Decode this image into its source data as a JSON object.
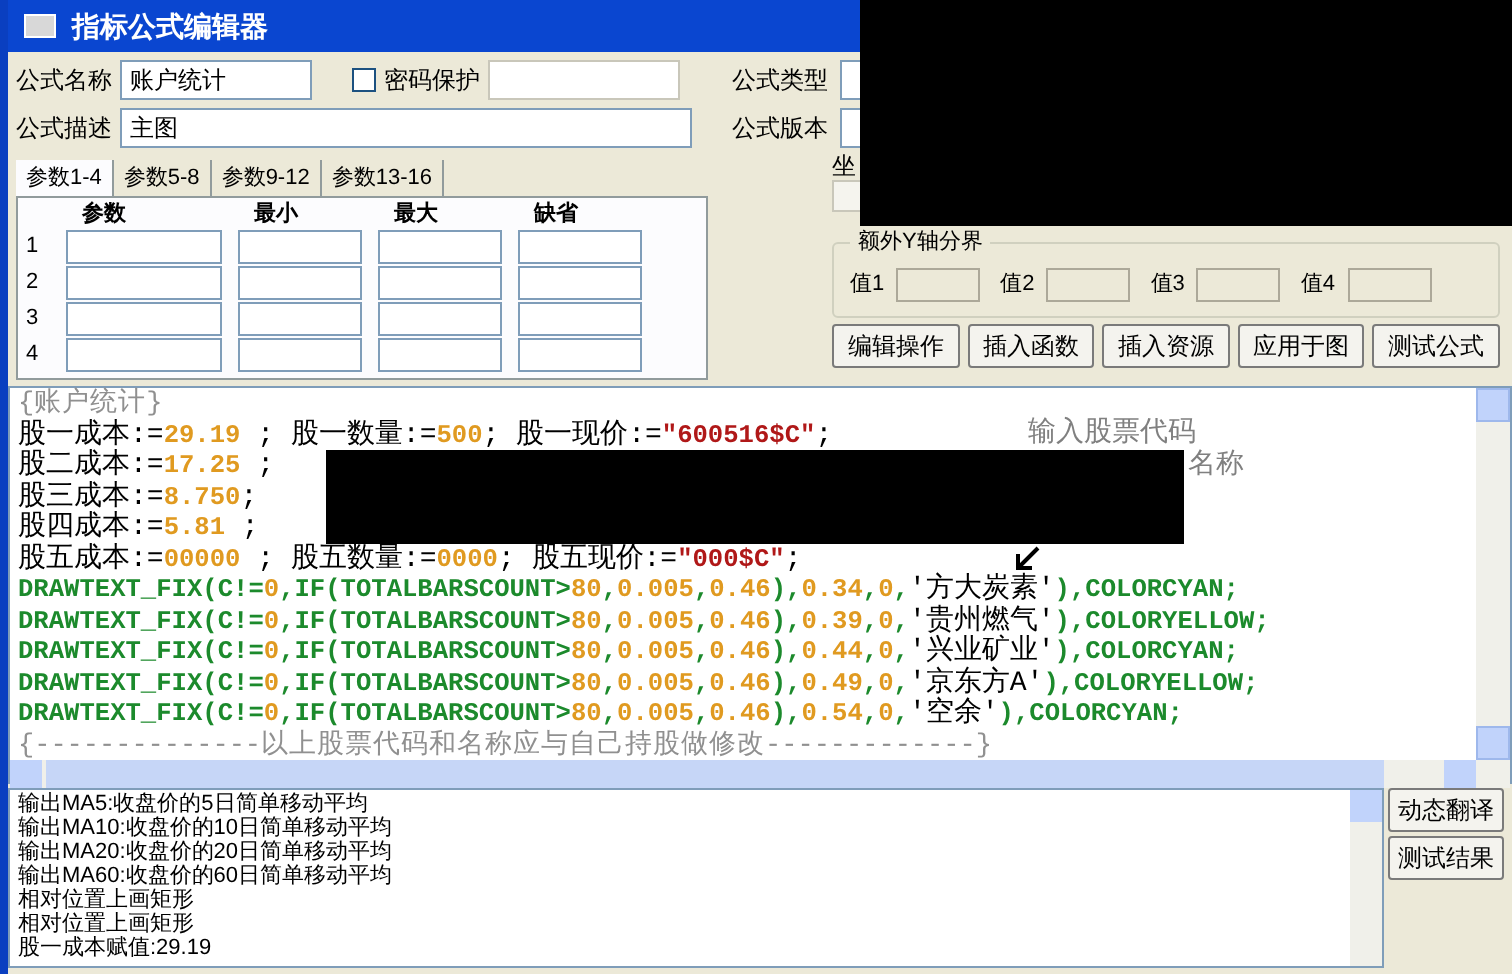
{
  "window": {
    "title": "指标公式编辑器"
  },
  "form": {
    "name_label": "公式名称",
    "name_value": "账户统计",
    "password": {
      "label": "密码保护",
      "checked": false
    },
    "type_label": "公式类型",
    "desc_label": "公式描述",
    "desc_value": "主图",
    "version_label": "公式版本",
    "axis_label": "坐"
  },
  "param_tabs": [
    {
      "label": "参数1-4",
      "selected": true
    },
    {
      "label": "参数5-8",
      "selected": false
    },
    {
      "label": "参数9-12",
      "selected": false
    },
    {
      "label": "参数13-16",
      "selected": false
    }
  ],
  "param_table": {
    "columns": [
      "参数",
      "最小",
      "最大",
      "缺省"
    ],
    "rows": [
      "1",
      "2",
      "3",
      "4"
    ]
  },
  "y_axis_group": {
    "title": "额外Y轴分界",
    "fields": [
      "值1",
      "值2",
      "值3",
      "值4"
    ]
  },
  "toolbar_buttons": [
    "编辑操作",
    "插入函数",
    "插入资源",
    "应用于图",
    "测试公式"
  ],
  "editor": {
    "lines": [
      {
        "kind": "code",
        "segments": [
          {
            "kind": "comment",
            "text": "{账户统计}"
          }
        ]
      },
      {
        "kind": "code",
        "segments": [
          {
            "kind": "plain",
            "text": "股一成本:="
          },
          {
            "kind": "number",
            "text": "29.19"
          },
          {
            "kind": "plain",
            "text": " ; 股一数量:="
          },
          {
            "kind": "number",
            "text": "500"
          },
          {
            "kind": "plain",
            "text": "; 股一现价:="
          },
          {
            "kind": "string",
            "text": "\"600516$C\""
          },
          {
            "kind": "plain",
            "text": ";"
          }
        ],
        "note": "输入股票代码"
      },
      {
        "kind": "redacted",
        "segments": [
          {
            "kind": "plain",
            "text": "股二成本:="
          },
          {
            "kind": "number",
            "text": "17.25"
          },
          {
            "kind": "plain",
            "text": " ;"
          }
        ],
        "note": "名称"
      },
      {
        "kind": "redacted",
        "segments": [
          {
            "kind": "plain",
            "text": "股三成本:="
          },
          {
            "kind": "number",
            "text": "8.750"
          },
          {
            "kind": "plain",
            "text": ";"
          }
        ]
      },
      {
        "kind": "redacted",
        "segments": [
          {
            "kind": "plain",
            "text": "股四成本:="
          },
          {
            "kind": "number",
            "text": "5.81"
          },
          {
            "kind": "plain",
            "text": " ;"
          }
        ]
      },
      {
        "kind": "code",
        "segments": [
          {
            "kind": "plain",
            "text": "股五成本:="
          },
          {
            "kind": "number",
            "text": "00000"
          },
          {
            "kind": "plain",
            "text": " ; 股五数量:="
          },
          {
            "kind": "number",
            "text": "0000"
          },
          {
            "kind": "plain",
            "text": "; 股五现价:="
          },
          {
            "kind": "string",
            "text": "\"000$C\""
          },
          {
            "kind": "plain",
            "text": ";"
          }
        ]
      },
      {
        "kind": "code",
        "segments": [
          {
            "kind": "func",
            "text": "DRAWTEXT_FIX(C!="
          },
          {
            "kind": "number",
            "text": "0"
          },
          {
            "kind": "func",
            "text": ",IF(TOTALBARSCOUNT>"
          },
          {
            "kind": "number",
            "text": "80"
          },
          {
            "kind": "func",
            "text": ","
          },
          {
            "kind": "number",
            "text": "0.005"
          },
          {
            "kind": "func",
            "text": ","
          },
          {
            "kind": "number",
            "text": "0.46"
          },
          {
            "kind": "func",
            "text": "),"
          },
          {
            "kind": "number",
            "text": "0.34"
          },
          {
            "kind": "func",
            "text": ","
          },
          {
            "kind": "number",
            "text": "0"
          },
          {
            "kind": "func",
            "text": ","
          },
          {
            "kind": "plain",
            "text": "'方大炭素'"
          },
          {
            "kind": "func",
            "text": "),COLORCYAN;"
          }
        ]
      },
      {
        "kind": "code",
        "segments": [
          {
            "kind": "func",
            "text": "DRAWTEXT_FIX(C!="
          },
          {
            "kind": "number",
            "text": "0"
          },
          {
            "kind": "func",
            "text": ",IF(TOTALBARSCOUNT>"
          },
          {
            "kind": "number",
            "text": "80"
          },
          {
            "kind": "func",
            "text": ","
          },
          {
            "kind": "number",
            "text": "0.005"
          },
          {
            "kind": "func",
            "text": ","
          },
          {
            "kind": "number",
            "text": "0.46"
          },
          {
            "kind": "func",
            "text": "),"
          },
          {
            "kind": "number",
            "text": "0.39"
          },
          {
            "kind": "func",
            "text": ","
          },
          {
            "kind": "number",
            "text": "0"
          },
          {
            "kind": "func",
            "text": ","
          },
          {
            "kind": "plain",
            "text": "'贵州燃气'"
          },
          {
            "kind": "func",
            "text": "),COLORYELLOW;"
          }
        ]
      },
      {
        "kind": "code",
        "segments": [
          {
            "kind": "func",
            "text": "DRAWTEXT_FIX(C!="
          },
          {
            "kind": "number",
            "text": "0"
          },
          {
            "kind": "func",
            "text": ",IF(TOTALBARSCOUNT>"
          },
          {
            "kind": "number",
            "text": "80"
          },
          {
            "kind": "func",
            "text": ","
          },
          {
            "kind": "number",
            "text": "0.005"
          },
          {
            "kind": "func",
            "text": ","
          },
          {
            "kind": "number",
            "text": "0.46"
          },
          {
            "kind": "func",
            "text": "),"
          },
          {
            "kind": "number",
            "text": "0.44"
          },
          {
            "kind": "func",
            "text": ","
          },
          {
            "kind": "number",
            "text": "0"
          },
          {
            "kind": "func",
            "text": ","
          },
          {
            "kind": "plain",
            "text": "'兴业矿业'"
          },
          {
            "kind": "func",
            "text": "),COLORCYAN;"
          }
        ]
      },
      {
        "kind": "code",
        "segments": [
          {
            "kind": "func",
            "text": "DRAWTEXT_FIX(C!="
          },
          {
            "kind": "number",
            "text": "0"
          },
          {
            "kind": "func",
            "text": ",IF(TOTALBARSCOUNT>"
          },
          {
            "kind": "number",
            "text": "80"
          },
          {
            "kind": "func",
            "text": ","
          },
          {
            "kind": "number",
            "text": "0.005"
          },
          {
            "kind": "func",
            "text": ","
          },
          {
            "kind": "number",
            "text": "0.46"
          },
          {
            "kind": "func",
            "text": "),"
          },
          {
            "kind": "number",
            "text": "0.49"
          },
          {
            "kind": "func",
            "text": ","
          },
          {
            "kind": "number",
            "text": "0"
          },
          {
            "kind": "func",
            "text": ","
          },
          {
            "kind": "plain",
            "text": "'京东方A'"
          },
          {
            "kind": "func",
            "text": "),COLORYELLOW;"
          }
        ]
      },
      {
        "kind": "code",
        "segments": [
          {
            "kind": "func",
            "text": "DRAWTEXT_FIX(C!="
          },
          {
            "kind": "number",
            "text": "0"
          },
          {
            "kind": "func",
            "text": ",IF(TOTALBARSCOUNT>"
          },
          {
            "kind": "number",
            "text": "80"
          },
          {
            "kind": "func",
            "text": ","
          },
          {
            "kind": "number",
            "text": "0.005"
          },
          {
            "kind": "func",
            "text": ","
          },
          {
            "kind": "number",
            "text": "0.46"
          },
          {
            "kind": "func",
            "text": "),"
          },
          {
            "kind": "number",
            "text": "0.54"
          },
          {
            "kind": "func",
            "text": ","
          },
          {
            "kind": "number",
            "text": "0"
          },
          {
            "kind": "func",
            "text": ","
          },
          {
            "kind": "plain",
            "text": "'空余'"
          },
          {
            "kind": "func",
            "text": "),COLORCYAN;"
          }
        ]
      },
      {
        "kind": "code",
        "segments": [
          {
            "kind": "comment",
            "text": "{--------------以上股票代码和名称应与自己持股做修改-------------}"
          }
        ]
      }
    ]
  },
  "output": {
    "lines": [
      "输出MA5:收盘价的5日简单移动平均",
      "输出MA10:收盘价的10日简单移动平均",
      "输出MA20:收盘价的20日简单移动平均",
      "输出MA60:收盘价的60日简单移动平均",
      "相对位置上画矩形",
      "相对位置上画矩形",
      "股一成本赋值:29.19"
    ]
  },
  "output_buttons": [
    "动态翻译",
    "测试结果"
  ]
}
